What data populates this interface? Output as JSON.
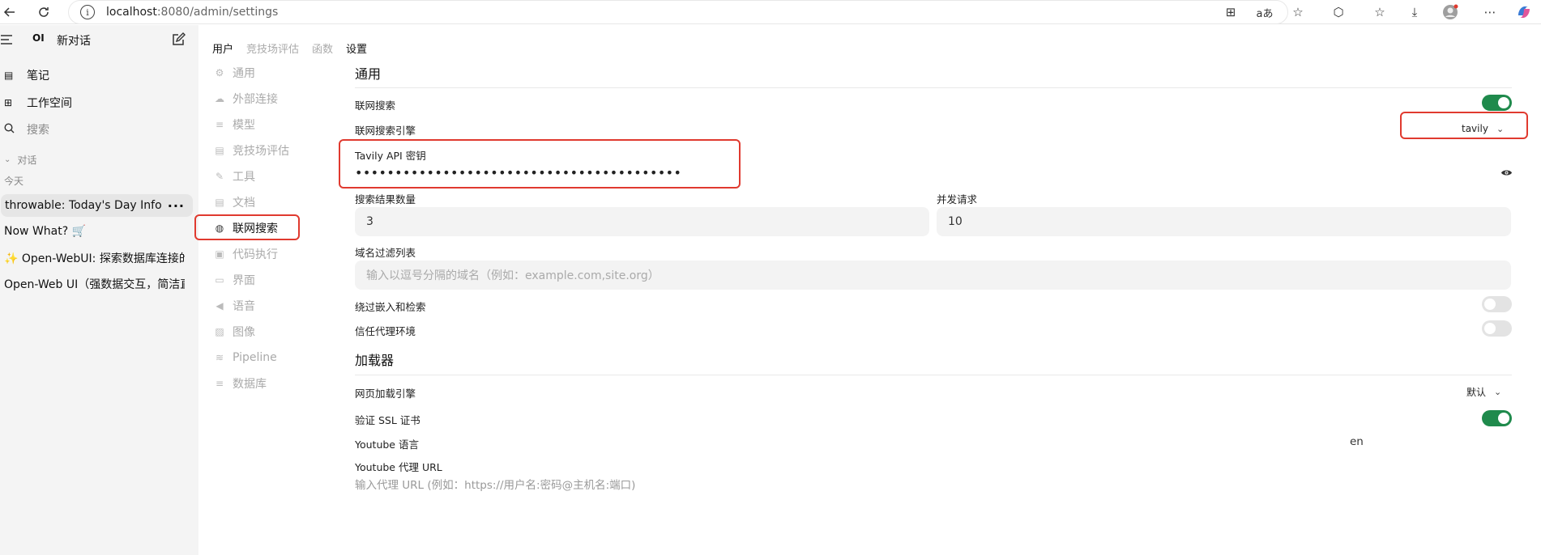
{
  "browser": {
    "url_host": "localhost",
    "url_rest": ":8080/admin/settings"
  },
  "sidebar": {
    "new_chat": "新对话",
    "logo_text": "OI",
    "notes": "笔记",
    "workspace": "工作空间",
    "search": "搜索",
    "chats_section": "对话",
    "today": "今天",
    "chats": [
      "throwable: Today's Day Info",
      "Now What? 🛒",
      "✨ Open-WebUI: 探索数据库连接的",
      "Open-Web UI（强数据交互，简洁直"
    ]
  },
  "admin_tabs": [
    "用户",
    "竞技场评估",
    "函数",
    "设置"
  ],
  "settings_nav": [
    "通用",
    "外部连接",
    "模型",
    "竞技场评估",
    "工具",
    "文档",
    "联网搜索",
    "代码执行",
    "界面",
    "语音",
    "图像",
    "Pipeline",
    "数据库"
  ],
  "main": {
    "general_title": "通用",
    "web_search_label": "联网搜索",
    "web_search_on": true,
    "engine_label": "联网搜索引擎",
    "engine_value": "tavily",
    "api_key_label": "Tavily API 密钥",
    "api_key_mask": "•••••••••••••••••••••••••••••••••••••••••",
    "result_count_label": "搜索结果数量",
    "result_count_value": "3",
    "concurrent_label": "并发请求",
    "concurrent_value": "10",
    "domain_filter_label": "域名过滤列表",
    "domain_filter_placeholder": "输入以逗号分隔的域名（例如：example.com,site.org）",
    "bypass_label": "绕过嵌入和检索",
    "bypass_on": false,
    "trust_proxy_label": "信任代理环境",
    "trust_proxy_on": false,
    "loader_title": "加载器",
    "loader_engine_label": "网页加载引擎",
    "loader_engine_value": "默认",
    "ssl_label": "验证 SSL 证书",
    "ssl_on": true,
    "youtube_lang_label": "Youtube 语言",
    "youtube_lang_value": "en",
    "youtube_proxy_label": "Youtube 代理 URL",
    "youtube_proxy_placeholder": "输入代理 URL (例如：https://用户名:密码@主机名:端口)"
  },
  "colors": {
    "toggle_on": "#1f8a4c",
    "highlight": "#e03a2f"
  }
}
